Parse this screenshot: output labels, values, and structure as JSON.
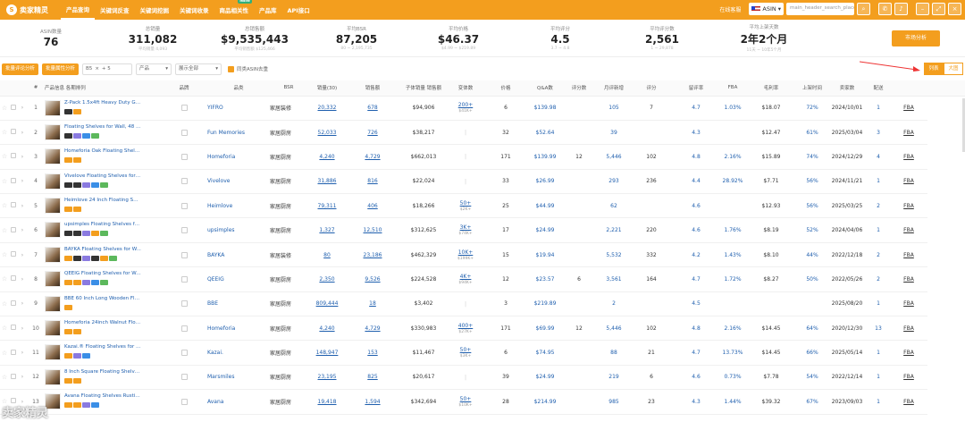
{
  "app": {
    "logo_text": "卖家精灵"
  },
  "nav": [
    {
      "label": "产品查询",
      "active": true
    },
    {
      "label": "关键词反查",
      "active": false
    },
    {
      "label": "关键词挖掘",
      "active": false
    },
    {
      "label": "关键词收录",
      "active": false
    },
    {
      "label": "商品相关性",
      "active": false,
      "badge": "NEW"
    },
    {
      "label": "产品库",
      "active": false
    },
    {
      "label": "API接口",
      "active": false
    }
  ],
  "topright": {
    "online": "在线客服",
    "asin_label": "ASIN",
    "search_placeholder": "main_header_search_placeholder"
  },
  "stats": [
    {
      "label": "ASIN数量",
      "value": "76",
      "sub": ""
    },
    {
      "label": "总销量",
      "value": "311,082",
      "sub": "平均销量 4,093"
    },
    {
      "label": "总销售额",
      "value": "$9,535,443",
      "sub": "平均销售额 $125,466"
    },
    {
      "label": "平均BSR",
      "value": "87,205",
      "sub": "80 ~ 2,195,735"
    },
    {
      "label": "平均价格",
      "value": "$46.37",
      "sub": "$4.99 ~ $219.89"
    },
    {
      "label": "平均评分",
      "value": "4.5",
      "sub": "3.7 ~ 4.8"
    },
    {
      "label": "平均评分数",
      "value": "2,561",
      "sub": "1 ~ 29,878"
    },
    {
      "label": "平均上架天数",
      "value": "2年2个月",
      "sub": "11天 ~ 10年5个月"
    }
  ],
  "market_button": "市场分析",
  "toolbar": {
    "btn1": "批量评论分析",
    "btn2": "批量属性分析",
    "filter_tag": "B5",
    "filter_more": "+ 5",
    "sel_product": "产品",
    "sel_show": "展示全部",
    "checkbox_label": "同类ASIN去重"
  },
  "view_toggle": {
    "list": "列表",
    "grid": "大图"
  },
  "columns": [
    "#",
    "产品信息 各期排列",
    "品牌",
    "品类",
    "BSR",
    "销量(30)",
    "销售额",
    "子体销量\n销售额",
    "变体数",
    "价格",
    "Q&A数",
    "评分数",
    "月评新增",
    "评分",
    "留评率",
    "FBA",
    "毛利率",
    "上架时间",
    "卖家数",
    "配送"
  ],
  "rows": [
    {
      "n": "1",
      "title": "Z-Pack 1.5x4ft Heavy Duty Gar...",
      "brand": "YIFRO",
      "cat": "家居装修",
      "bsr": "20,332",
      "sales": "678",
      "revenue": "$94,906",
      "child": "200+",
      "child2": "$41K+",
      "var": "6",
      "price": "$139.98",
      "qa": "",
      "ratings": "105",
      "newr": "7",
      "score": "4.7",
      "rr": "1.03%",
      "fba": "$18.07",
      "gm": "72%",
      "date": "2024/10/01",
      "sellers": "1",
      "ship": "FBA"
    },
    {
      "n": "2",
      "title": "Floating Shelves for Wall, 48 In...",
      "brand": "Fun Memories",
      "cat": "家居厨房",
      "bsr": "52,033",
      "sales": "726",
      "revenue": "$38,217",
      "child": "",
      "child2": "",
      "var": "32",
      "price": "$52.64",
      "qa": "",
      "ratings": "39",
      "newr": "",
      "score": "4.3",
      "rr": "",
      "fba": "$12.47",
      "gm": "61%",
      "date": "2025/03/04",
      "sellers": "3",
      "ship": "FBA"
    },
    {
      "n": "3",
      "title": "Homeforia Oak Floating Shelve...",
      "brand": "Homeforia",
      "cat": "家居厨房",
      "bsr": "4,240",
      "sales": "4,729",
      "revenue": "$662,013",
      "child": "",
      "child2": "",
      "var": "171",
      "price": "$139.99",
      "qa": "12",
      "ratings": "5,446",
      "newr": "102",
      "score": "4.8",
      "rr": "2.16%",
      "fba": "$15.89",
      "gm": "74%",
      "date": "2024/12/29",
      "sellers": "4",
      "ship": "FBA"
    },
    {
      "n": "4",
      "title": "Vivelove Floating Shelves for ...",
      "brand": "Vivelove",
      "cat": "家居厨房",
      "bsr": "31,886",
      "sales": "816",
      "revenue": "$22,024",
      "child": "",
      "child2": "",
      "var": "33",
      "price": "$26.99",
      "qa": "",
      "ratings": "293",
      "newr": "236",
      "score": "4.4",
      "rr": "28.92%",
      "fba": "$7.71",
      "gm": "56%",
      "date": "2024/11/21",
      "sellers": "1",
      "ship": "FBA"
    },
    {
      "n": "5",
      "title": "Heimlove 24 Inch Floating Shel...",
      "brand": "Heimlove",
      "cat": "家居厨房",
      "bsr": "79,311",
      "sales": "406",
      "revenue": "$18,266",
      "child": "50+",
      "child2": "$2K+",
      "var": "25",
      "price": "$44.99",
      "qa": "",
      "ratings": "62",
      "newr": "",
      "score": "4.6",
      "rr": "",
      "fba": "$12.93",
      "gm": "56%",
      "date": "2025/03/25",
      "sellers": "2",
      "ship": "FBA"
    },
    {
      "n": "6",
      "title": "upsimples Floating Shelves fo...",
      "brand": "upsimples",
      "cat": "家居厨房",
      "bsr": "1,327",
      "sales": "12,510",
      "revenue": "$312,625",
      "child": "3K+",
      "child2": "$74K+",
      "var": "17",
      "price": "$24.99",
      "qa": "",
      "ratings": "2,221",
      "newr": "220",
      "score": "4.6",
      "rr": "1.76%",
      "fba": "$8.19",
      "gm": "52%",
      "date": "2024/04/06",
      "sellers": "1",
      "ship": "FBA"
    },
    {
      "n": "7",
      "title": "BAYKA Floating Shelves for W...",
      "brand": "BAYKA",
      "cat": "家居装修",
      "bsr": "80",
      "sales": "23,186",
      "revenue": "$462,329",
      "child": "10K+",
      "child2": "$199K+",
      "var": "15",
      "price": "$19.94",
      "qa": "",
      "ratings": "5,532",
      "newr": "332",
      "score": "4.2",
      "rr": "1.43%",
      "fba": "$8.10",
      "gm": "44%",
      "date": "2022/12/18",
      "sellers": "2",
      "ship": "FBA"
    },
    {
      "n": "8",
      "title": "QEEIG Floating Shelves for Wa...",
      "brand": "QEEIG",
      "cat": "家居厨房",
      "bsr": "2,350",
      "sales": "9,526",
      "revenue": "$224,528",
      "child": "4K+",
      "child2": "$94K+",
      "var": "12",
      "price": "$23.57",
      "qa": "6",
      "ratings": "3,561",
      "newr": "164",
      "score": "4.7",
      "rr": "1.72%",
      "fba": "$8.27",
      "gm": "50%",
      "date": "2022/05/26",
      "sellers": "2",
      "ship": "FBA"
    },
    {
      "n": "9",
      "title": "BBE 60 Inch Long Wooden Flo...",
      "brand": "BBE",
      "cat": "家居厨房",
      "bsr": "809,444",
      "sales": "18",
      "revenue": "$3,402",
      "child": "",
      "child2": "",
      "var": "3",
      "price": "$219.89",
      "qa": "",
      "ratings": "2",
      "newr": "",
      "score": "4.5",
      "rr": "",
      "fba": "",
      "gm": "",
      "date": "2025/08/20",
      "sellers": "1",
      "ship": "FBA"
    },
    {
      "n": "10",
      "title": "Homeforia 24inch Walnut Floa...",
      "brand": "Homeforia",
      "cat": "家居厨房",
      "bsr": "4,240",
      "sales": "4,729",
      "revenue": "$330,983",
      "child": "400+",
      "child2": "$27K+",
      "var": "171",
      "price": "$69.99",
      "qa": "12",
      "ratings": "5,446",
      "newr": "102",
      "score": "4.8",
      "rr": "2.16%",
      "fba": "$14.45",
      "gm": "64%",
      "date": "2020/12/30",
      "sellers": "13",
      "ship": "FBA"
    },
    {
      "n": "11",
      "title": "Kazai.® Floating Shelves for W...",
      "brand": "Kazai.",
      "cat": "家居厨房",
      "bsr": "148,947",
      "sales": "153",
      "revenue": "$11,467",
      "child": "50+",
      "child2": "$3K+",
      "var": "6",
      "price": "$74.95",
      "qa": "",
      "ratings": "88",
      "newr": "21",
      "score": "4.7",
      "rr": "13.73%",
      "fba": "$14.45",
      "gm": "66%",
      "date": "2025/05/14",
      "sellers": "1",
      "ship": "FBA"
    },
    {
      "n": "12",
      "title": "8 Inch Square Floating Shelves...",
      "brand": "Marsmiles",
      "cat": "家居厨房",
      "bsr": "23,195",
      "sales": "825",
      "revenue": "$20,617",
      "child": "",
      "child2": "",
      "var": "39",
      "price": "$24.99",
      "qa": "",
      "ratings": "219",
      "newr": "6",
      "score": "4.6",
      "rr": "0.73%",
      "fba": "$7.78",
      "gm": "54%",
      "date": "2022/12/14",
      "sellers": "1",
      "ship": "FBA"
    },
    {
      "n": "13",
      "title": "Avana Floating Shelves Rustic ...",
      "brand": "Avana",
      "cat": "家居厨房",
      "bsr": "19,418",
      "sales": "1,594",
      "revenue": "$342,694",
      "child": "50+",
      "child2": "$10K+",
      "var": "28",
      "price": "$214.99",
      "qa": "",
      "ratings": "985",
      "newr": "23",
      "score": "4.3",
      "rr": "1.44%",
      "fba": "$39.32",
      "gm": "67%",
      "date": "2023/09/03",
      "sellers": "1",
      "ship": "FBA"
    }
  ],
  "watermark": "卖家精灵"
}
